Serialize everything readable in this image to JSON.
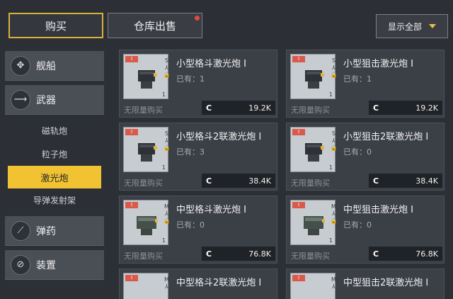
{
  "tabs": {
    "buy": "购买",
    "sell": "仓库出售"
  },
  "filter": {
    "label": "显示全部"
  },
  "sidebar": {
    "categories": [
      {
        "label": "舰船"
      },
      {
        "label": "武器"
      }
    ],
    "weapon_subs": [
      "磁轨炮",
      "粒子炮",
      "激光炮",
      "导弹发射架"
    ],
    "more": [
      {
        "label": "弹药"
      },
      {
        "label": "装置"
      }
    ]
  },
  "items": [
    {
      "name": "小型格斗激光炮 I",
      "owned": "已有：1",
      "unlimited": "无限量购买",
      "currency": "C",
      "price": "19.2K",
      "size": "S",
      "level": "1"
    },
    {
      "name": "小型狙击激光炮 I",
      "owned": "已有：1",
      "unlimited": "无限量购买",
      "currency": "C",
      "price": "19.2K",
      "size": "S",
      "level": "1"
    },
    {
      "name": "小型格斗2联激光炮 I",
      "owned": "已有：3",
      "unlimited": "无限量购买",
      "currency": "C",
      "price": "38.4K",
      "size": "S",
      "level": "1"
    },
    {
      "name": "小型狙击2联激光炮 I",
      "owned": "已有：0",
      "unlimited": "无限量购买",
      "currency": "C",
      "price": "38.4K",
      "size": "S",
      "level": "1"
    },
    {
      "name": "中型格斗激光炮 I",
      "owned": "已有：0",
      "unlimited": "无限量购买",
      "currency": "C",
      "price": "76.8K",
      "size": "M",
      "level": "1"
    },
    {
      "name": "中型狙击激光炮 I",
      "owned": "已有：0",
      "unlimited": "无限量购买",
      "currency": "C",
      "price": "76.8K",
      "size": "M",
      "level": "1"
    },
    {
      "name": "中型格斗2联激光炮 I",
      "size": "M"
    },
    {
      "name": "中型狙击2联激光炮 I",
      "size": "M"
    }
  ],
  "tier_badge": "I"
}
